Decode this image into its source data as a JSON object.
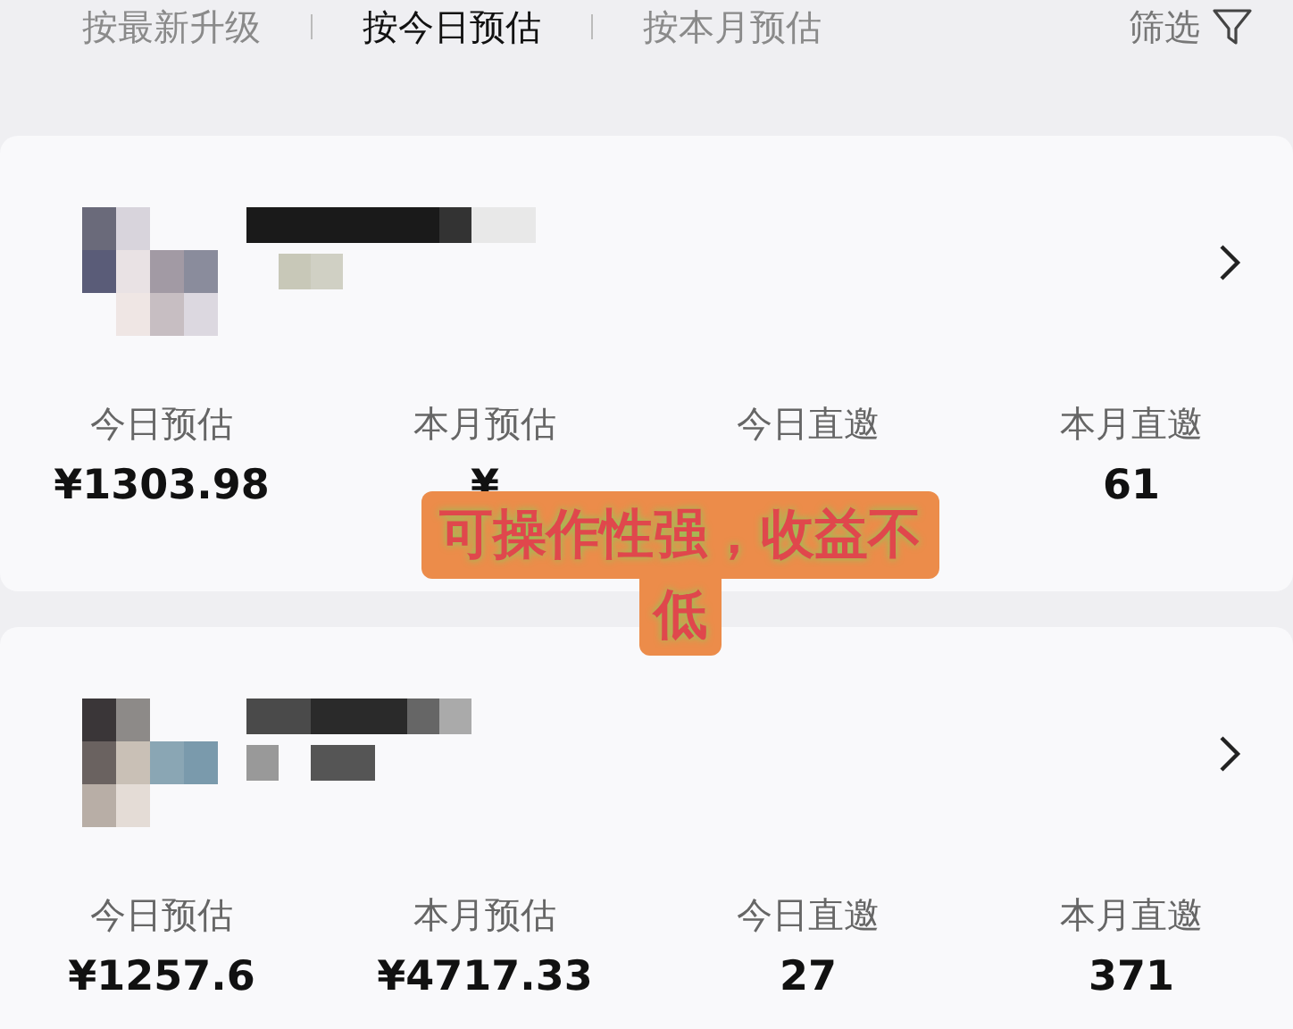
{
  "sort_tabs": [
    {
      "label": "按最新升级",
      "selected": false
    },
    {
      "label": "按今日预估",
      "selected": true
    },
    {
      "label": "按本月预估",
      "selected": false
    }
  ],
  "filter": {
    "label": "筛选"
  },
  "cards": [
    {
      "stats": [
        {
          "label": "今日预估",
          "value": "¥1303.98"
        },
        {
          "label": "本月预估",
          "value": "¥"
        },
        {
          "label": "今日直邀"
        },
        {
          "label": "本月直邀",
          "value": "61"
        }
      ]
    },
    {
      "stats": [
        {
          "label": "今日预估",
          "value": "¥1257.6"
        },
        {
          "label": "本月预估",
          "value": "¥4717.33"
        },
        {
          "label": "今日直邀",
          "value": "27"
        },
        {
          "label": "本月直邀",
          "value": "371"
        }
      ]
    }
  ],
  "overlay_caption": {
    "line_1": "可操作性强，收益不",
    "line_2": "低"
  }
}
